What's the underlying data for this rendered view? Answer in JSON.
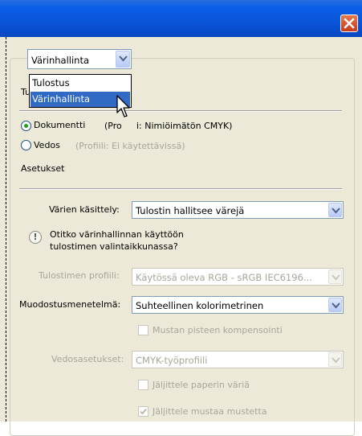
{
  "window": {
    "close_label": "close"
  },
  "group": {
    "mode_select": {
      "value": "Värinhallinta"
    },
    "mode_options": [
      {
        "label": "Tulostus",
        "selected": false
      },
      {
        "label": "Värinhallinta",
        "selected": true
      }
    ],
    "partial_label": "Tu"
  },
  "print": {
    "document_label": "Dokumentti",
    "document_profile_pre": "(Pro",
    "document_profile_post": "i: Nimiöimätön CMYK)",
    "proof_label": "Vedos",
    "proof_profile": "(Profiili: Ei käytettävissä)",
    "document_selected": true
  },
  "settings": {
    "heading": "Asetukset",
    "color_handling_label": "Värien käsittely:",
    "color_handling_value": "Tulostin hallitsee värejä",
    "info_line1": "Otitko värinhallinnan käyttöön",
    "info_line2": "tulostimen valintaikkunassa?",
    "printer_profile_label": "Tulostimen profiili:",
    "printer_profile_value": "Käytössä oleva RGB - sRGB IEC6196...",
    "rendering_intent_label": "Muodostusmenetelmä:",
    "rendering_intent_value": "Suhteellinen kolorimetrinen",
    "black_point_label": "Mustan pisteen kompensointi",
    "black_point_checked": false,
    "proof_setup_label": "Vedosasetukset:",
    "proof_setup_value": "CMYK-työprofiili",
    "simulate_paper_label": "Jäljittele paperin väriä",
    "simulate_paper_checked": false,
    "simulate_black_label": "Jäljittele mustaa mustetta",
    "simulate_black_checked": true
  },
  "colors": {
    "titlebar": "#0a55d8",
    "dialog_bg": "#ece9d8",
    "selection": "#316ac5",
    "close_button": "#d24a26"
  }
}
